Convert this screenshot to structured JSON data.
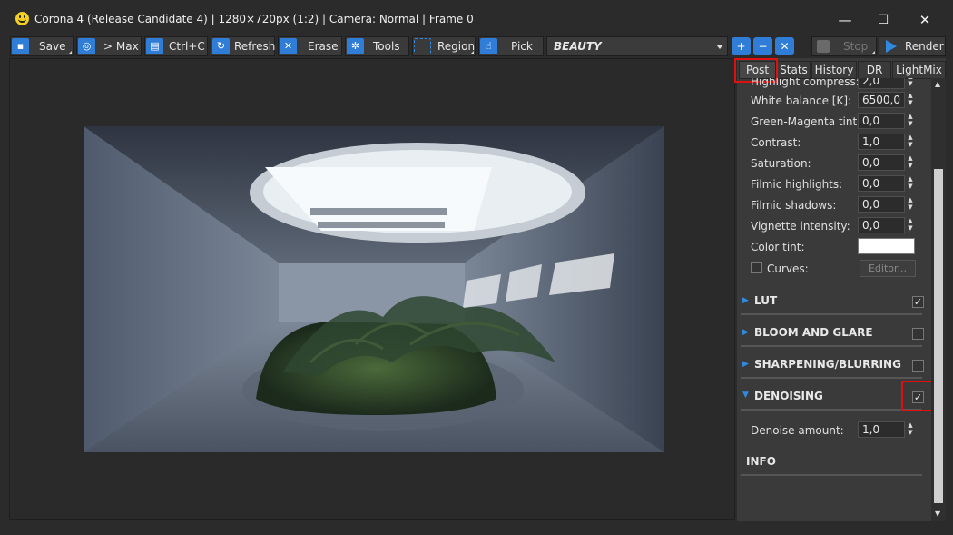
{
  "window": {
    "title": "Corona 4 (Release Candidate 4) | 1280×720px (1:2) | Camera: Normal | Frame 0",
    "minimize": "—",
    "maximize": "☐",
    "close": "✕"
  },
  "toolbar": {
    "save": "Save",
    "max": "> Max",
    "copy": "Ctrl+C",
    "refresh": "Refresh",
    "erase": "Erase",
    "tools": "Tools",
    "region": "Region",
    "pick": "Pick",
    "pass": "BEAUTY",
    "stop": "Stop",
    "render": "Render"
  },
  "tabs": [
    "Post",
    "Stats",
    "History",
    "DR",
    "LightMix"
  ],
  "active_tab": "Post",
  "post": {
    "clipped_row": {
      "label": "Highlight compress:",
      "value": "2,0"
    },
    "rows": [
      {
        "label": "White balance [K]:",
        "value": "6500,0"
      },
      {
        "label": "Green-Magenta tint:",
        "value": "0,0"
      },
      {
        "label": "Contrast:",
        "value": "1,0"
      },
      {
        "label": "Saturation:",
        "value": "0,0"
      },
      {
        "label": "Filmic highlights:",
        "value": "0,0"
      },
      {
        "label": "Filmic shadows:",
        "value": "0,0"
      },
      {
        "label": "Vignette intensity:",
        "value": "0,0"
      }
    ],
    "color_tint": {
      "label": "Color tint:",
      "color": "#ffffff"
    },
    "curves": {
      "label": "Curves:",
      "button": "Editor..."
    },
    "sections": [
      {
        "name": "LUT",
        "checked": true
      },
      {
        "name": "BLOOM AND GLARE",
        "checked": false
      },
      {
        "name": "SHARPENING/BLURRING",
        "checked": false
      },
      {
        "name": "DENOISING",
        "checked": true,
        "expanded": true
      }
    ],
    "denoise": {
      "label": "Denoise amount:",
      "value": "1,0"
    },
    "info": "INFO"
  },
  "colors": {
    "accent": "#2f7dd6",
    "highlight": "#e01010",
    "background": "#2b2b2b",
    "panel": "#3a3a3a"
  }
}
